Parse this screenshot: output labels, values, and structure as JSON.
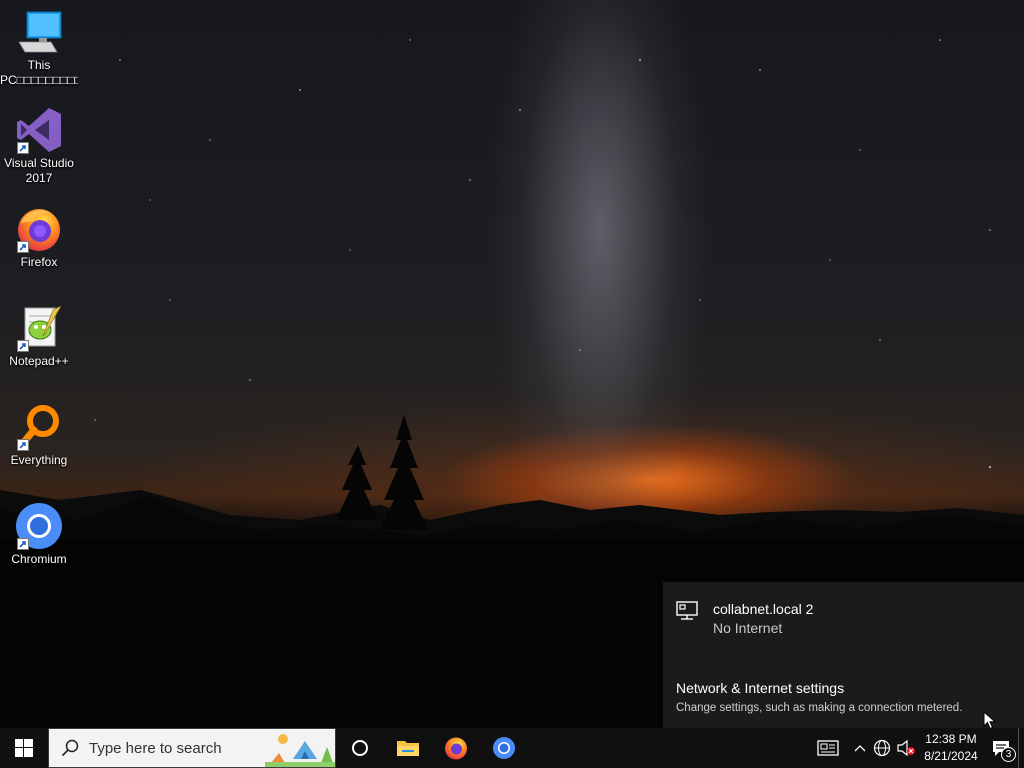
{
  "desktop": {
    "icons": [
      {
        "label": "This PC□□□□□□□□□□□□□...",
        "line1": "This",
        "line2": "PC□□□□□□□□□□□□□...",
        "icon": "computer-icon"
      },
      {
        "line1": "Visual Studio",
        "line2": "2017",
        "icon": "visual-studio-icon"
      },
      {
        "line1": "Firefox",
        "icon": "firefox-icon"
      },
      {
        "line1": "Notepad++",
        "icon": "notepadpp-icon"
      },
      {
        "line1": "Everything",
        "icon": "everything-search-icon"
      },
      {
        "line1": "Chromium",
        "icon": "chromium-icon"
      }
    ]
  },
  "network_flyout": {
    "network_name": "collabnet.local 2",
    "network_status": "No Internet",
    "settings_link": "Network & Internet settings",
    "settings_description": "Change settings, such as making a connection metered."
  },
  "taskbar": {
    "search_placeholder": "Type here to search",
    "pinned": [
      "start-icon",
      "cortana-icon",
      "file-explorer-icon",
      "firefox-icon",
      "chromium-icon"
    ],
    "tray": {
      "time": "12:38 PM",
      "date": "8/21/2024",
      "notification_count": "3"
    }
  },
  "colors": {
    "taskbar": "#101010",
    "flyout": "#1c1c1c",
    "accent_firefox": "#ff7139",
    "accent_vs": "#865fc5"
  }
}
